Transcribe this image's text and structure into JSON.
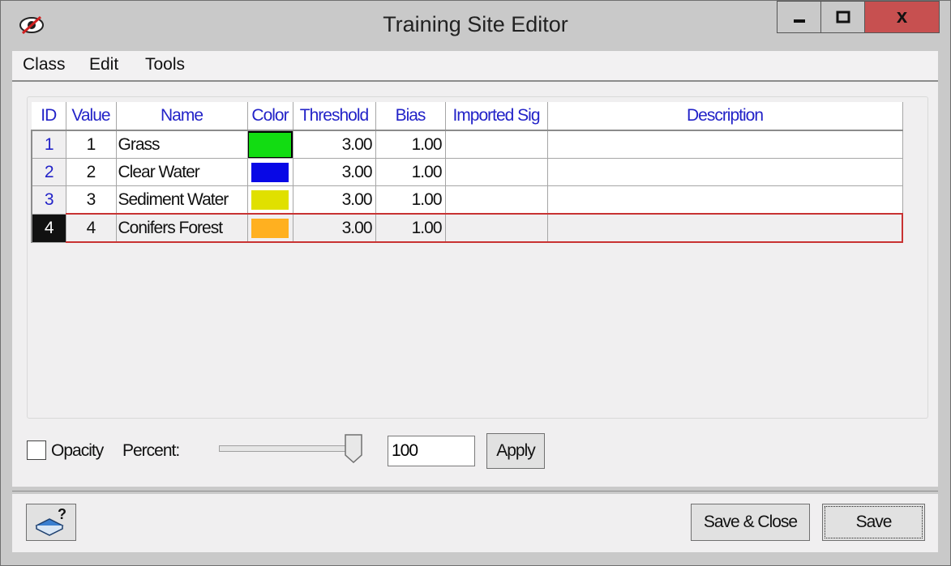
{
  "window": {
    "title": "Training Site Editor",
    "controls": {
      "minimize": "minimize-icon",
      "maximize": "maximize-icon",
      "close_label": "x"
    },
    "app_icon": "eye-icon"
  },
  "menu": {
    "items": [
      "Class",
      "Edit",
      "Tools"
    ]
  },
  "table": {
    "columns": [
      "ID",
      "Value",
      "Name",
      "Color",
      "Threshold",
      "Bias",
      "Imported Sig",
      "Description"
    ],
    "rows": [
      {
        "id": "1",
        "value": "1",
        "name": "Grass",
        "color": "#12dc12",
        "threshold": "3.00",
        "bias": "1.00",
        "imported_sig": "",
        "description": ""
      },
      {
        "id": "2",
        "value": "2",
        "name": "Clear Water",
        "color": "#0808e6",
        "threshold": "3.00",
        "bias": "1.00",
        "imported_sig": "",
        "description": ""
      },
      {
        "id": "3",
        "value": "3",
        "name": "Sediment Water",
        "color": "#e0e000",
        "threshold": "3.00",
        "bias": "1.00",
        "imported_sig": "",
        "description": ""
      },
      {
        "id": "4",
        "value": "4",
        "name": "Conifers Forest",
        "color": "#ffb020",
        "threshold": "3.00",
        "bias": "1.00",
        "imported_sig": "",
        "description": ""
      }
    ],
    "selected_row": 3,
    "selection_color": "#c83232"
  },
  "opacity": {
    "checkbox_label": "Opacity",
    "percent_label": "Percent:",
    "percent_value": "100",
    "slider_level": 1.0,
    "apply_label": "Apply"
  },
  "footer": {
    "help_icon": "help-book-icon",
    "save_close_label": "Save & Close",
    "save_label": "Save"
  }
}
